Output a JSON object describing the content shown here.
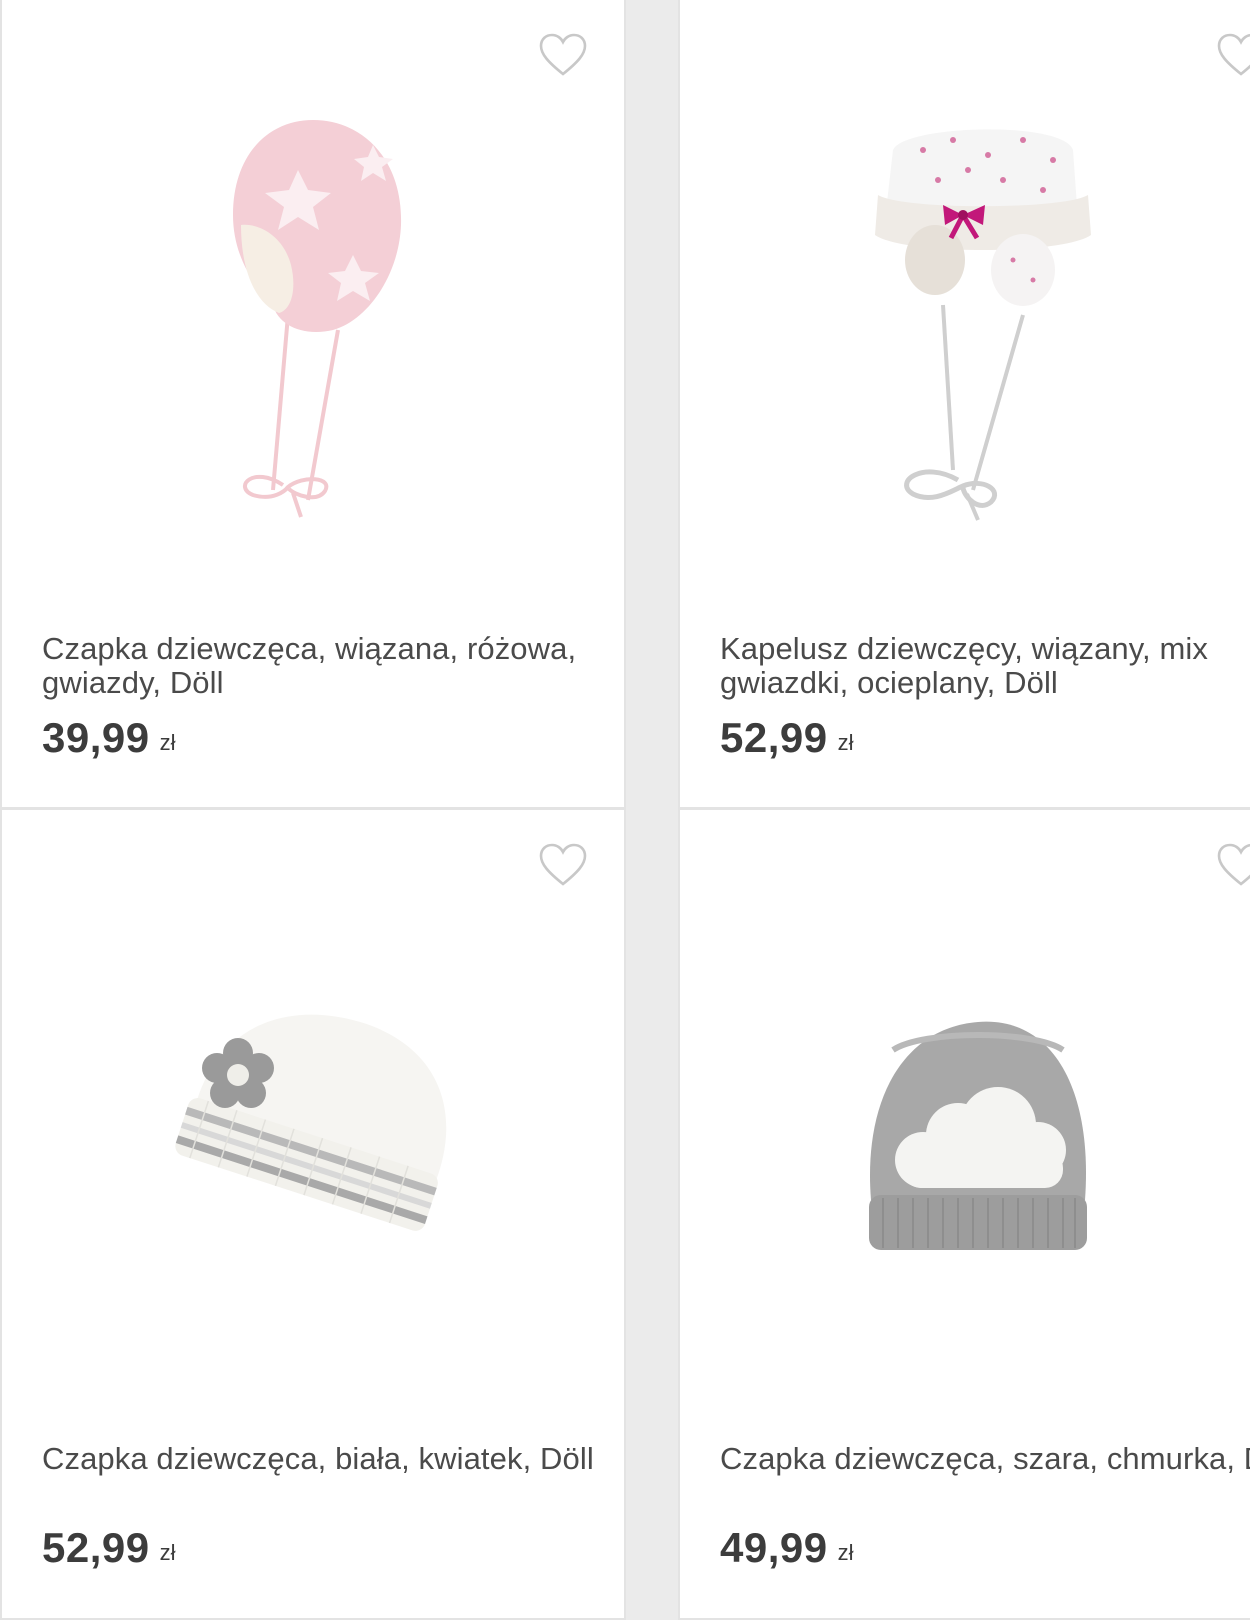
{
  "products": [
    {
      "title": "Czapka dziewczęca, wiązana, różowa, gwiazdy, Döll",
      "price": "39,99",
      "currency": "zł",
      "image_icon": "pink-star-hat-image",
      "favorite_icon": "heart-outline-icon"
    },
    {
      "title": "Kapelusz dziewczęcy, wiązany, mix gwiazdki, ocieplany, Döll",
      "price": "52,99",
      "currency": "zł",
      "image_icon": "white-dotted-hat-image",
      "favorite_icon": "heart-outline-icon"
    },
    {
      "title": "Czapka dziewczęca, biała, kwiatek, Döll",
      "price": "52,99",
      "currency": "zł",
      "image_icon": "white-flower-hat-image",
      "favorite_icon": "heart-outline-icon"
    },
    {
      "title": "Czapka dziewczęca, szara, chmurka, Döll",
      "price": "49,99",
      "currency": "zł",
      "image_icon": "grey-cloud-hat-image",
      "favorite_icon": "heart-outline-icon"
    }
  ],
  "colors": {
    "background": "#ebebeb",
    "card": "#ffffff",
    "text": "#4a4a4a",
    "heart": "#c8c8c8"
  }
}
